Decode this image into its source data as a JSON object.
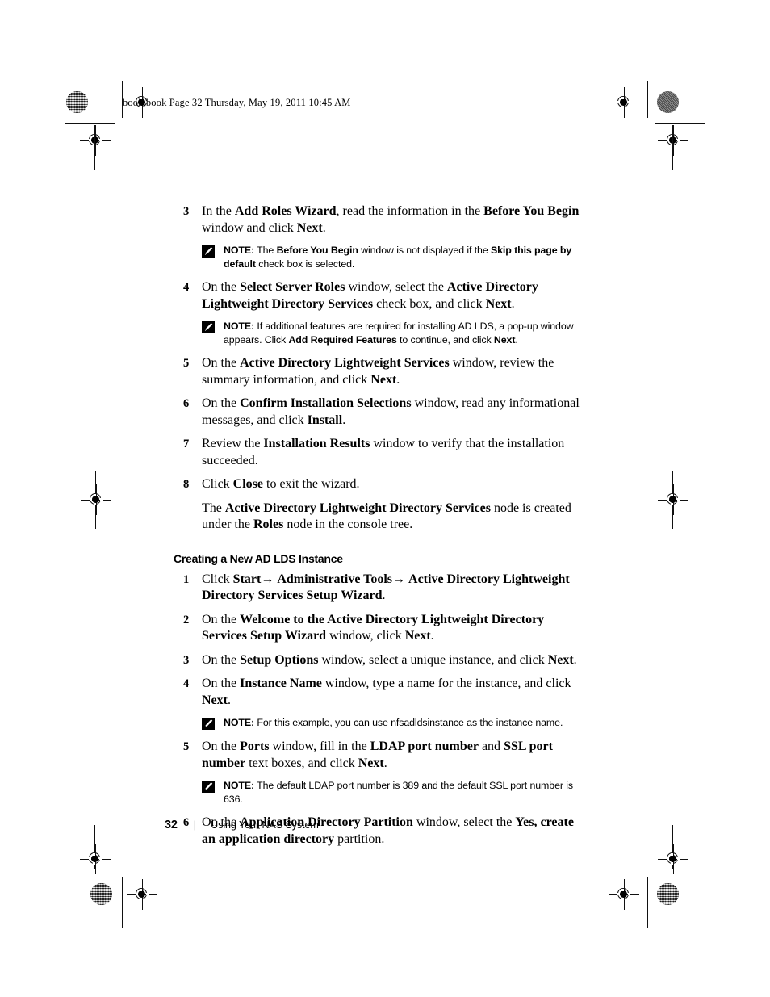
{
  "document": {
    "file_header": "book.book  Page 32  Thursday, May 19, 2011  10:45 AM",
    "footer": {
      "page_number": "32",
      "separator": "|",
      "title": "Using Your NAS System"
    }
  },
  "section_heading": "Creating a New AD LDS Instance",
  "note_label": "NOTE:",
  "steps_part1": [
    {
      "number": "3",
      "html": "In the <b>Add Roles Wizard</b>, read the information in the <b>Before You Begin</b> window and click <b>Next</b>."
    },
    {
      "number": "4",
      "html": "On the <b>Select Server Roles</b> window, select the <b>Active Directory Lightweight Directory Services</b> check box, and click <b>Next</b>."
    },
    {
      "number": "5",
      "html": "On the <b>Active Directory Lightweight Services</b> window, review the summary information, and click <b>Next</b>."
    },
    {
      "number": "6",
      "html": "On the <b>Confirm Installation Selections</b> window, read any informational messages, and click <b>Install</b>."
    },
    {
      "number": "7",
      "html": "Review the <b>Installation Results</b> window to verify that the installation succeeded."
    },
    {
      "number": "8",
      "html": "Click <b>Close</b> to exit the wizard."
    }
  ],
  "continuation_after_step8": "The <b>Active Directory Lightweight Directory Services</b> node is created under the <b>Roles</b> node in the console tree.",
  "notes": {
    "note_step3": "The <b>Before You Begin</b> window is not displayed if the <b>Skip this page by default</b> check box is selected.",
    "note_step4": "If additional features are required for installing AD LDS, a pop-up window appears. Click <b>Add Required Features</b> to continue, and click <b>Next</b>.",
    "note_step4b": "For this example, you can use nfsadldsinstance as the instance name.",
    "note_step5b": "The default LDAP port number is 389 and the default SSL port number is 636."
  },
  "steps_part2": [
    {
      "number": "1",
      "html": "Click <b>Start</b>&#8594; <b>Administrative Tools</b>&#8594; <b>Active Directory Lightweight Directory Services Setup Wizard</b>."
    },
    {
      "number": "2",
      "html": "On the <b>Welcome to the Active Directory Lightweight Directory Services Setup Wizard</b> window, click <b>Next</b>."
    },
    {
      "number": "3",
      "html": "On the <b>Setup Options</b> window, select a unique instance, and click <b>Next</b>."
    },
    {
      "number": "4",
      "html": "On the <b>Instance Name</b> window, type a name for the instance, and click <b>Next</b>."
    },
    {
      "number": "5",
      "html": "On the <b>Ports</b> window, fill in the <b>LDAP port number</b> and <b>SSL port number</b> text boxes, and click <b>Next</b>."
    },
    {
      "number": "6",
      "html": "On the <b>Application Directory Partition</b> window, select the <b>Yes, create an application directory</b> partition."
    }
  ],
  "icons": {
    "note": "pencil-icon",
    "registration": "registration-target-icon",
    "halftone": "halftone-dot-icon"
  }
}
